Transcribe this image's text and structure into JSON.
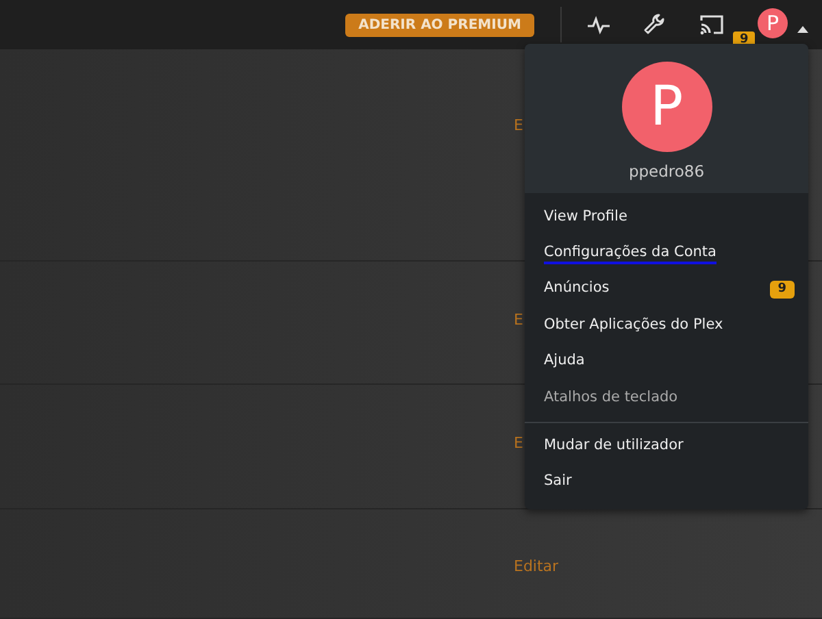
{
  "top_bar": {
    "premium_button": "ADERIR AO PREMIUM",
    "avatar_letter": "P",
    "notification_count": "9"
  },
  "rows": [
    {
      "edit_link": "E"
    },
    {
      "edit_link": "E"
    },
    {
      "edit_link": "E"
    },
    {
      "edit_link": "Editar"
    }
  ],
  "account_menu": {
    "avatar_letter": "P",
    "username": "ppedro86",
    "items": [
      {
        "label": "View Profile",
        "selected": false,
        "disabled": false
      },
      {
        "label": "Configurações da Conta",
        "selected": true,
        "disabled": false
      },
      {
        "label": "Anúncios",
        "selected": false,
        "disabled": false,
        "badge": "9"
      },
      {
        "label": "Obter Aplicações do Plex",
        "selected": false,
        "disabled": false
      },
      {
        "label": "Ajuda",
        "selected": false,
        "disabled": false
      },
      {
        "label": "Atalhos de teclado",
        "selected": false,
        "disabled": true,
        "separator_after": true
      },
      {
        "label": "Mudar de utilizador",
        "selected": false,
        "disabled": false
      },
      {
        "label": "Sair",
        "selected": false,
        "disabled": false
      }
    ]
  }
}
